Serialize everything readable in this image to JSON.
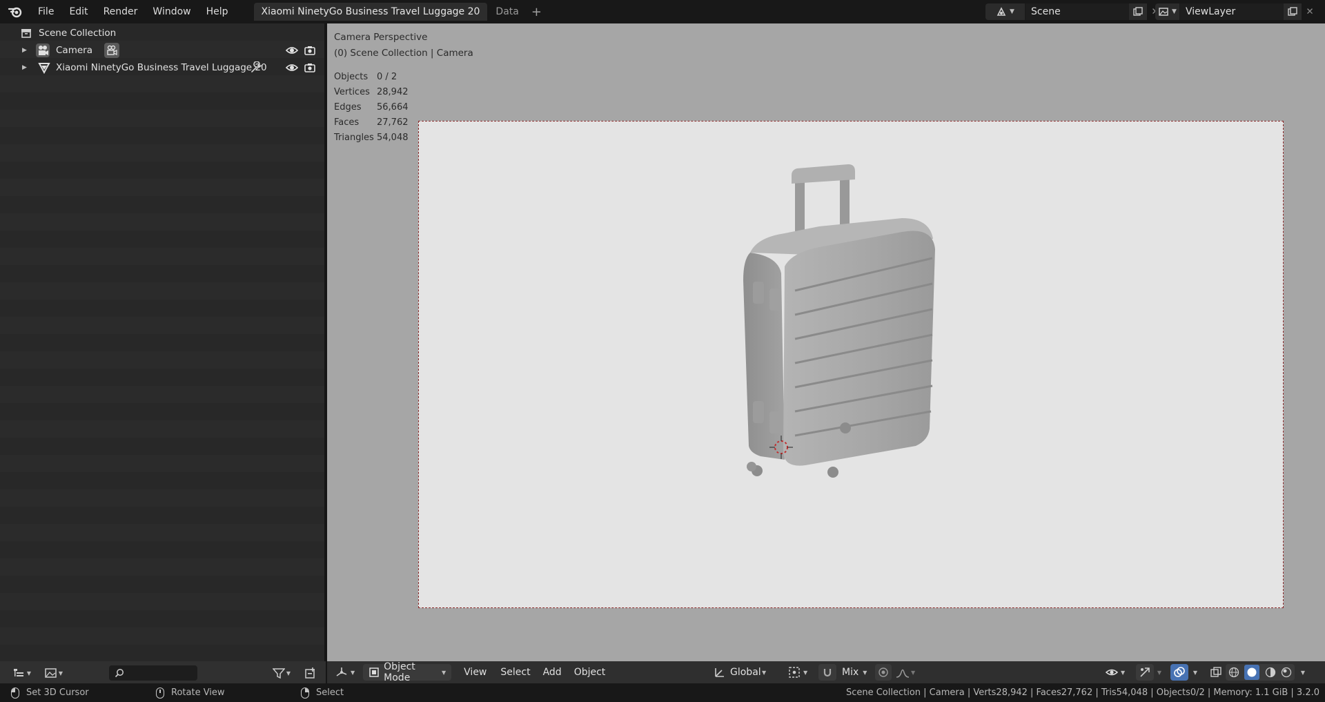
{
  "menu": {
    "file": "File",
    "edit": "Edit",
    "render": "Render",
    "window": "Window",
    "help": "Help"
  },
  "tabs": {
    "active": "Xiaomi NinetyGo Business Travel Luggage 20",
    "second": "Data",
    "add": "+"
  },
  "scene": {
    "name": "Scene"
  },
  "view_layer": {
    "name": "ViewLayer"
  },
  "outliner": {
    "collection": "Scene Collection",
    "items": [
      {
        "label": "Camera"
      },
      {
        "label": "Xiaomi NinetyGo Business Travel Luggage 20"
      }
    ]
  },
  "viewport": {
    "perspective": "Camera Perspective",
    "context": "(0) Scene Collection | Camera",
    "stats": [
      {
        "k": "Objects",
        "v": "0 / 2"
      },
      {
        "k": "Vertices",
        "v": "28,942"
      },
      {
        "k": "Edges",
        "v": "56,664"
      },
      {
        "k": "Faces",
        "v": "27,762"
      },
      {
        "k": "Triangles",
        "v": "54,048"
      }
    ]
  },
  "header": {
    "mode": "Object Mode",
    "view": "View",
    "select": "Select",
    "add": "Add",
    "object": "Object",
    "orientation": "Global",
    "snap": "Mix"
  },
  "status": {
    "lmb": "Set 3D Cursor",
    "mmb": "Rotate View",
    "rmb": "Select",
    "right": "Scene Collection | Camera | Verts28,942 | Faces27,762 | Tris54,048 | Objects0/2 | Memory: 1.1 GiB | 3.2.0"
  },
  "colors": {
    "accent": "#4772b3",
    "frame_border": "#8a2a2a"
  }
}
